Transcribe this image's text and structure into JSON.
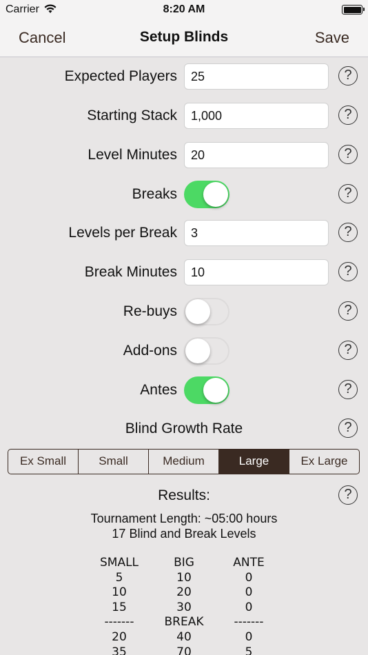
{
  "status": {
    "carrier": "Carrier",
    "time": "8:20 AM"
  },
  "nav": {
    "cancel": "Cancel",
    "title": "Setup Blinds",
    "save": "Save"
  },
  "fields": {
    "expected_players": {
      "label": "Expected Players",
      "value": "25"
    },
    "starting_stack": {
      "label": "Starting Stack",
      "value": "1,000"
    },
    "level_minutes": {
      "label": "Level Minutes",
      "value": "20"
    },
    "levels_per_break": {
      "label": "Levels per Break",
      "value": "3"
    },
    "break_minutes": {
      "label": "Break Minutes",
      "value": "10"
    }
  },
  "toggles": {
    "breaks": {
      "label": "Breaks",
      "on": true
    },
    "rebuys": {
      "label": "Re-buys",
      "on": false
    },
    "addons": {
      "label": "Add-ons",
      "on": false
    },
    "antes": {
      "label": "Antes",
      "on": true
    }
  },
  "help_glyph": "?",
  "growth": {
    "label": "Blind Growth Rate",
    "options": [
      "Ex Small",
      "Small",
      "Medium",
      "Large",
      "Ex Large"
    ],
    "selected": "Large"
  },
  "results": {
    "heading": "Results:",
    "length": "Tournament Length: ~05:00 hours",
    "levels_count": "17 Blind and Break Levels",
    "headers": [
      "SMALL",
      "BIG",
      "ANTE"
    ],
    "rows": [
      [
        "5",
        "10",
        "0"
      ],
      [
        "10",
        "20",
        "0"
      ],
      [
        "15",
        "30",
        "0"
      ],
      [
        "-------",
        "BREAK",
        "-------"
      ],
      [
        "20",
        "40",
        "0"
      ],
      [
        "35",
        "70",
        "5"
      ]
    ]
  },
  "colors": {
    "accent": "#3a2a22",
    "toggle_on": "#4cd964",
    "background": "#e8e6e6"
  }
}
